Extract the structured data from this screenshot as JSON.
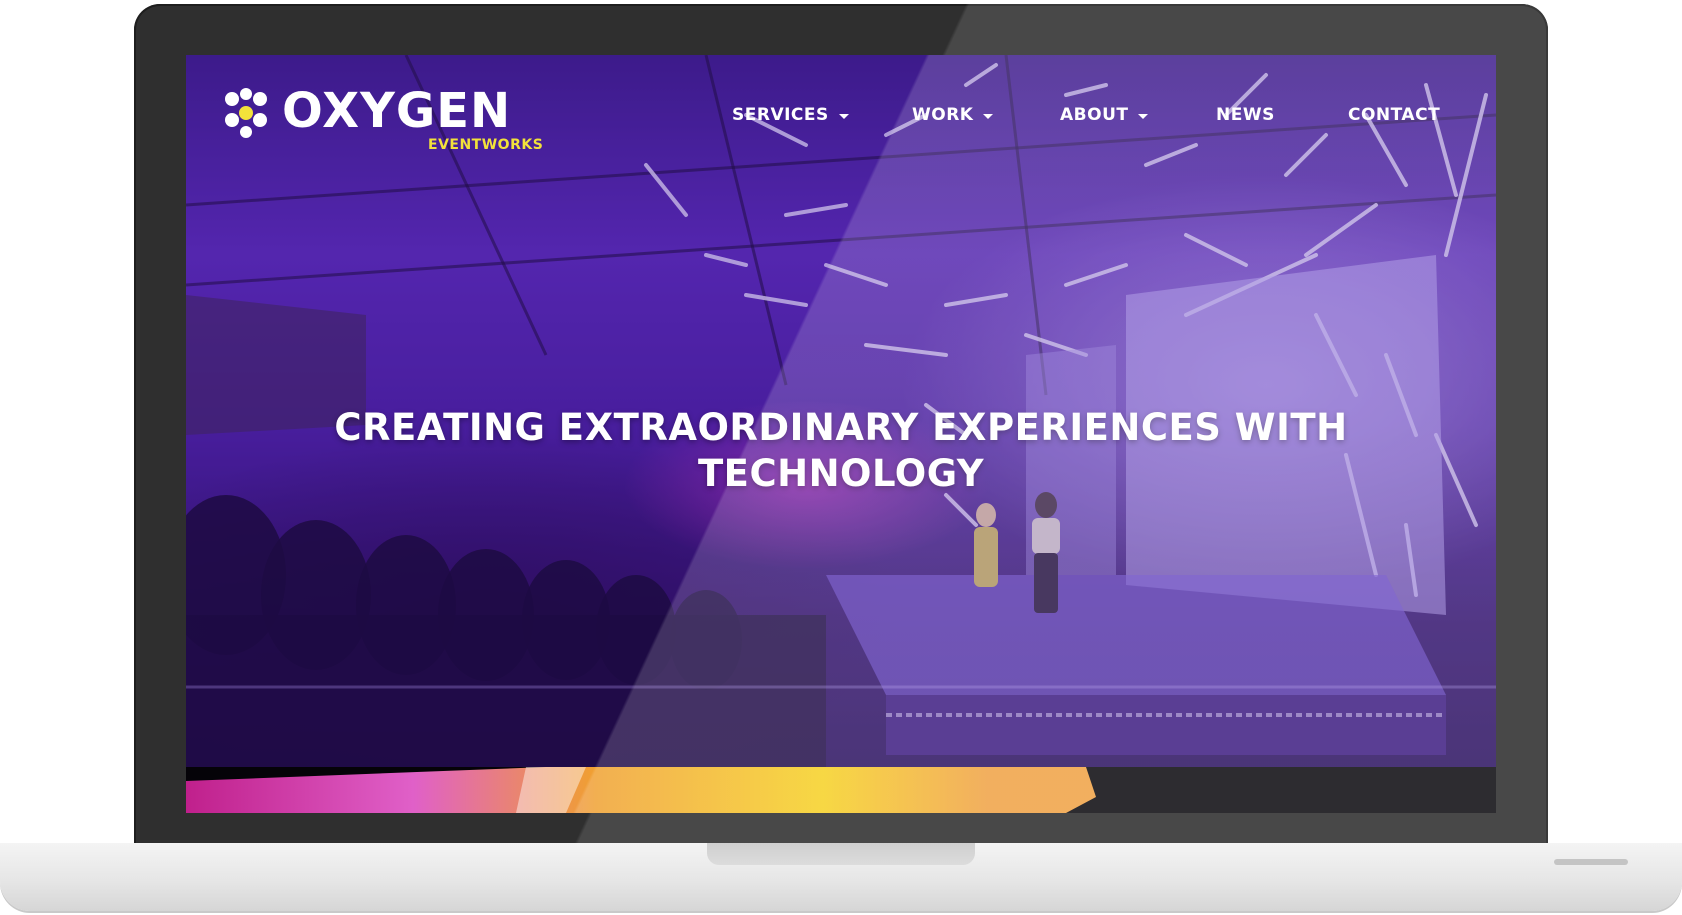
{
  "site": {
    "brand": {
      "name": "OXYGEN",
      "tagline": "EVENTWORKS",
      "mark_icon": "dots-cluster-icon",
      "tagline_color": "#f2e23a"
    },
    "nav": {
      "items": [
        {
          "label": "SERVICES",
          "has_dropdown": true
        },
        {
          "label": "WORK",
          "has_dropdown": true
        },
        {
          "label": "ABOUT",
          "has_dropdown": true
        },
        {
          "label": "NEWS",
          "has_dropdown": false
        },
        {
          "label": "CONTACT",
          "has_dropdown": false
        }
      ]
    },
    "hero": {
      "headline_line1": "CREATING EXTRAORDINARY EXPERIENCES WITH",
      "headline_line2": "TECHNOLOGY",
      "overlay_color": "#4a1e9a"
    }
  },
  "device": {
    "bezel_color": "#2f2f2f",
    "base_color": "#e6e6e6"
  }
}
